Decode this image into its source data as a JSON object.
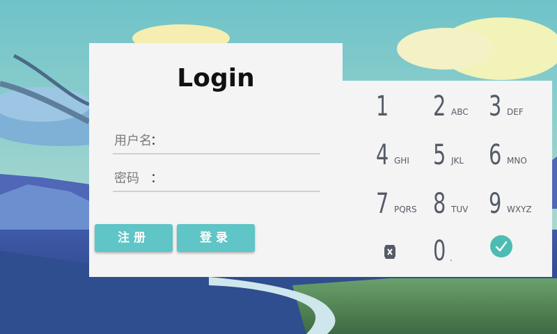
{
  "login": {
    "title": "Login",
    "username_label": "用户名",
    "password_label": "密码",
    "colon": "：",
    "username_value": "",
    "password_value": "",
    "register_label": "注册",
    "login_label": "登录"
  },
  "keypad": {
    "keys": [
      {
        "num": "1",
        "letters": ""
      },
      {
        "num": "2",
        "letters": "ABC"
      },
      {
        "num": "3",
        "letters": "DEF"
      },
      {
        "num": "4",
        "letters": "GHI"
      },
      {
        "num": "5",
        "letters": "JKL"
      },
      {
        "num": "6",
        "letters": "MNO"
      },
      {
        "num": "7",
        "letters": "PQRS"
      },
      {
        "num": "8",
        "letters": "TUV"
      },
      {
        "num": "9",
        "letters": "WXYZ"
      },
      {
        "num": "0",
        "letters": "."
      }
    ],
    "delete_icon": "backspace-icon",
    "confirm_icon": "checkmark-icon"
  },
  "colors": {
    "accent": "#5fc5c6",
    "confirm": "#4dbdb3",
    "panel": "#f4f4f4"
  }
}
